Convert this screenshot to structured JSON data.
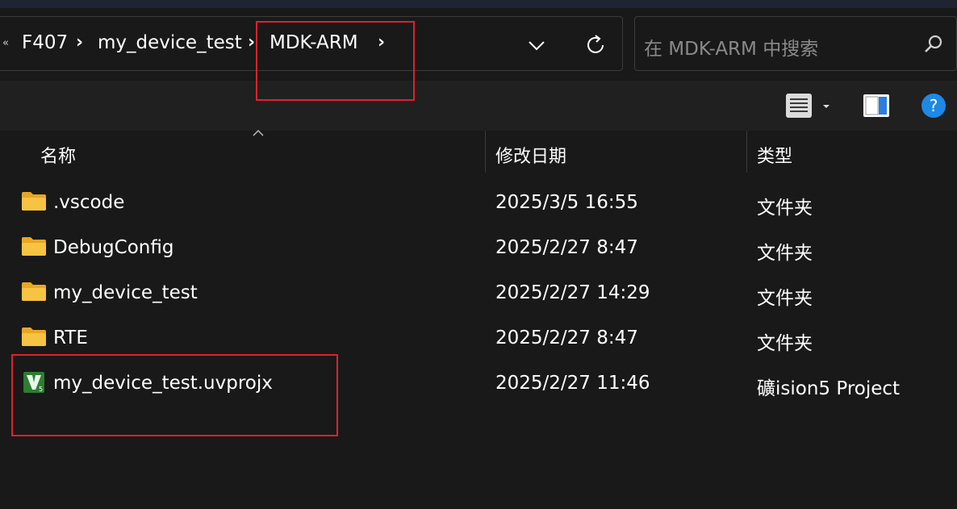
{
  "breadcrumb": {
    "items": [
      "F407",
      "my_device_test",
      "MDK-ARM"
    ],
    "separator": "›"
  },
  "search": {
    "placeholder": "在 MDK-ARM 中搜索"
  },
  "columns": {
    "name": "名称",
    "date": "修改日期",
    "type": "类型"
  },
  "files": [
    {
      "name": ".vscode",
      "date": "2025/3/5 16:55",
      "type": "文件夹",
      "icon": "folder-icon"
    },
    {
      "name": "DebugConfig",
      "date": "2025/2/27 8:47",
      "type": "文件夹",
      "icon": "folder-icon"
    },
    {
      "name": "my_device_test",
      "date": "2025/2/27 14:29",
      "type": "文件夹",
      "icon": "folder-icon"
    },
    {
      "name": "RTE",
      "date": "2025/2/27 8:47",
      "type": "文件夹",
      "icon": "folder-icon"
    },
    {
      "name": "my_device_test.uvprojx",
      "date": "2025/2/27 11:46",
      "type": "礦ision5 Project",
      "icon": "uvision-project-icon"
    }
  ],
  "colors": {
    "background": "#191919",
    "command_bar": "#202020",
    "folder": "#f6c343",
    "uvision_green": "#2e7d32",
    "annotation_red": "#e0212b",
    "help_blue": "#1e88e5"
  }
}
